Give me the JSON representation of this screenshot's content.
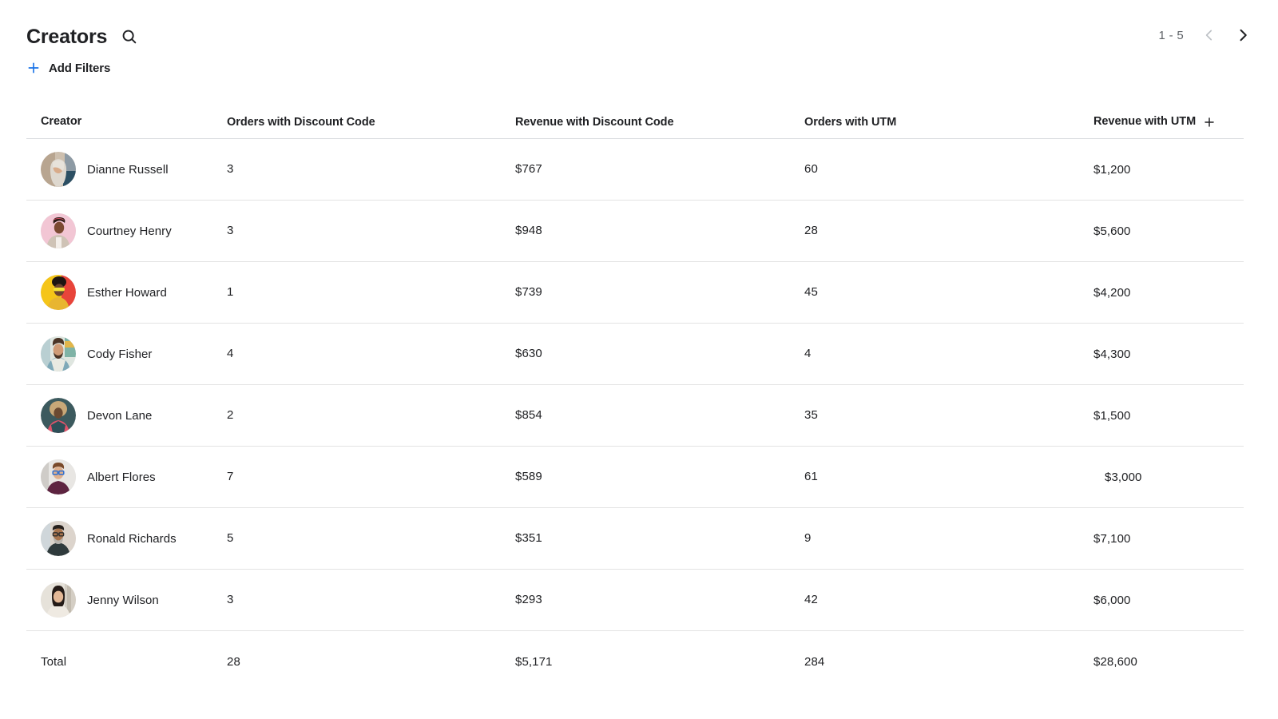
{
  "header": {
    "title": "Creators",
    "search_icon": "search-icon",
    "add_filters_label": "Add Filters",
    "add_filters_icon": "plus-icon",
    "accent_color": "#1a73e8"
  },
  "pagination": {
    "range": "1 - 5",
    "prev_icon": "chevron-left-icon",
    "next_icon": "chevron-right-icon",
    "prev_color": "#bdc1c6",
    "next_color": "#202124"
  },
  "table": {
    "columns": [
      "Creator",
      "Orders with Discount Code",
      "Revenue with Discount Code",
      "Orders with UTM",
      "Revenue with UTM"
    ],
    "add_column_icon": "plus-icon",
    "rows": [
      {
        "creator": "Dianne Russell",
        "orders_discount": "3",
        "revenue_discount": "$767",
        "orders_utm": "60",
        "revenue_utm": "$1,200"
      },
      {
        "creator": "Courtney Henry",
        "orders_discount": "3",
        "revenue_discount": "$948",
        "orders_utm": "28",
        "revenue_utm": "$5,600"
      },
      {
        "creator": "Esther Howard",
        "orders_discount": "1",
        "revenue_discount": "$739",
        "orders_utm": "45",
        "revenue_utm": "$4,200"
      },
      {
        "creator": "Cody Fisher",
        "orders_discount": "4",
        "revenue_discount": "$630",
        "orders_utm": "4",
        "revenue_utm": "$4,300"
      },
      {
        "creator": "Devon Lane",
        "orders_discount": "2",
        "revenue_discount": "$854",
        "orders_utm": "35",
        "revenue_utm": "$1,500"
      },
      {
        "creator": "Albert Flores",
        "orders_discount": "7",
        "revenue_discount": "$589",
        "orders_utm": "61",
        "revenue_utm": "$3,000"
      },
      {
        "creator": "Ronald Richards",
        "orders_discount": "5",
        "revenue_discount": "$351",
        "orders_utm": "9",
        "revenue_utm": "$7,100"
      },
      {
        "creator": "Jenny Wilson",
        "orders_discount": "3",
        "revenue_discount": "$293",
        "orders_utm": "42",
        "revenue_utm": "$6,000"
      }
    ],
    "total": {
      "label": "Total",
      "orders_discount": "28",
      "revenue_discount": "$5,171",
      "orders_utm": "284",
      "revenue_utm": "$28,600"
    }
  }
}
